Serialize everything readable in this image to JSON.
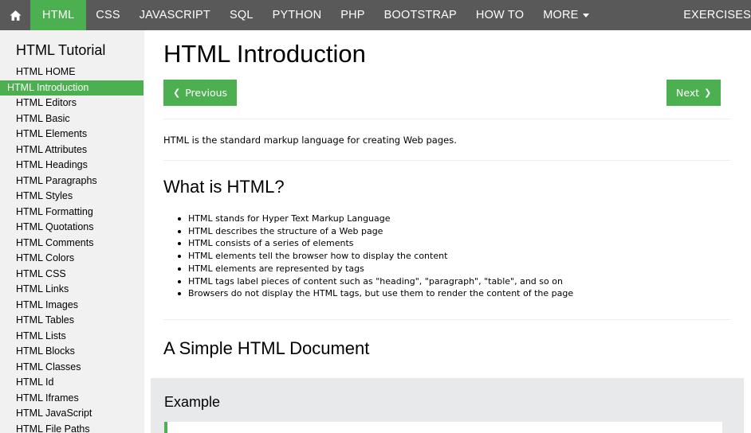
{
  "nav": {
    "home_icon": "home-icon",
    "items": [
      "HTML",
      "CSS",
      "JAVASCRIPT",
      "SQL",
      "PYTHON",
      "PHP",
      "BOOTSTRAP",
      "HOW TO",
      "MORE"
    ],
    "exercises": "EXERCISES",
    "active_color": "#4caf50",
    "bar_color": "#595959"
  },
  "sidebar": {
    "title": "HTML Tutorial",
    "items": [
      "HTML HOME",
      "HTML Introduction",
      "HTML Editors",
      "HTML Basic",
      "HTML Elements",
      "HTML Attributes",
      "HTML Headings",
      "HTML Paragraphs",
      "HTML Styles",
      "HTML Formatting",
      "HTML Quotations",
      "HTML Comments",
      "HTML Colors",
      "HTML CSS",
      "HTML Links",
      "HTML Images",
      "HTML Tables",
      "HTML Lists",
      "HTML Blocks",
      "HTML Classes",
      "HTML Id",
      "HTML Iframes",
      "HTML JavaScript",
      "HTML File Paths"
    ],
    "active_index": 1
  },
  "main": {
    "title": "HTML Introduction",
    "prev_label": "Previous",
    "next_label": "Next",
    "intro": "HTML is the standard markup language for creating Web pages.",
    "what_heading": "What is HTML?",
    "bullets": [
      "HTML stands for Hyper Text Markup Language",
      "HTML describes the structure of a Web page",
      "HTML consists of a series of elements",
      "HTML elements tell the browser how to display the content",
      "HTML elements are represented by tags",
      "HTML tags label pieces of content such as \"heading\", \"paragraph\", \"table\", and so on",
      "Browsers do not display the HTML tags, but use them to render the content of the page"
    ],
    "simple_heading": "A Simple HTML Document",
    "example_title": "Example"
  }
}
